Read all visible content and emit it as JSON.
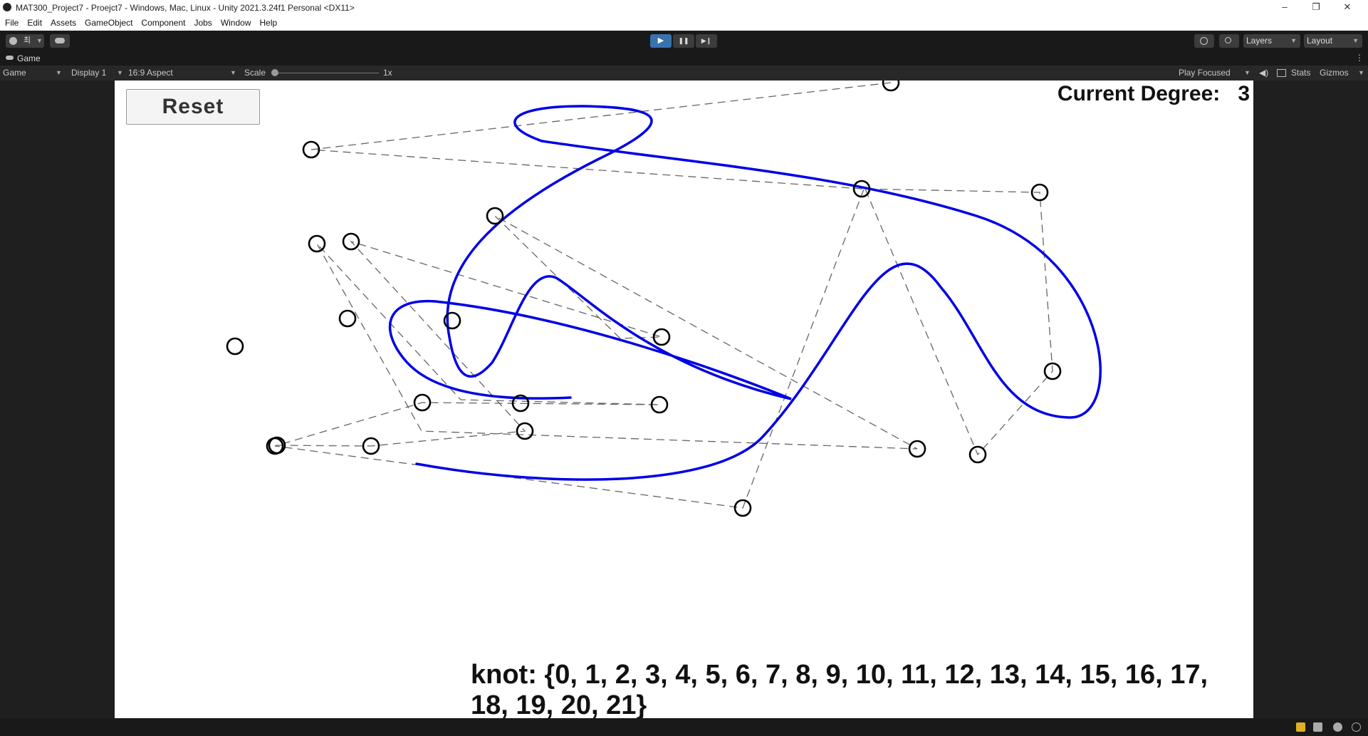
{
  "window": {
    "title": "MAT300_Project7 - Proejct7 - Windows, Mac, Linux - Unity 2021.3.24f1 Personal <DX11>",
    "controls": {
      "minimize": "–",
      "maximize": "❐",
      "close": "✕"
    }
  },
  "menu": [
    "File",
    "Edit",
    "Assets",
    "GameObject",
    "Component",
    "Jobs",
    "Window",
    "Help"
  ],
  "toolbar": {
    "account_initial": "최",
    "layers_label": "Layers",
    "layout_label": "Layout",
    "play_icon": "▶",
    "pause_icon": "❚❚",
    "step_icon": "▶❙"
  },
  "tab": {
    "label": "Game",
    "more": "⋮"
  },
  "gamebar": {
    "mode": "Game",
    "display": "Display 1",
    "aspect": "16:9 Aspect",
    "scale_label": "Scale",
    "scale_value": "1x",
    "play_focused": "Play Focused",
    "stats": "Stats",
    "gizmos": "Gizmos"
  },
  "scene": {
    "reset_label": "Reset",
    "degree_label": "Current Degree:",
    "degree_value": "3",
    "knot_text": "knot: {0, 1, 2, 3, 4, 5, 6, 7, 8, 9, 10, 11, 12, 13, 14, 15, 16, 17, 18, 19, 20, 21}"
  },
  "colors": {
    "curve": "#0000e6",
    "viewport_bg": "#ffffff",
    "editor_bg": "#191919",
    "play_active": "#3a72b0"
  }
}
